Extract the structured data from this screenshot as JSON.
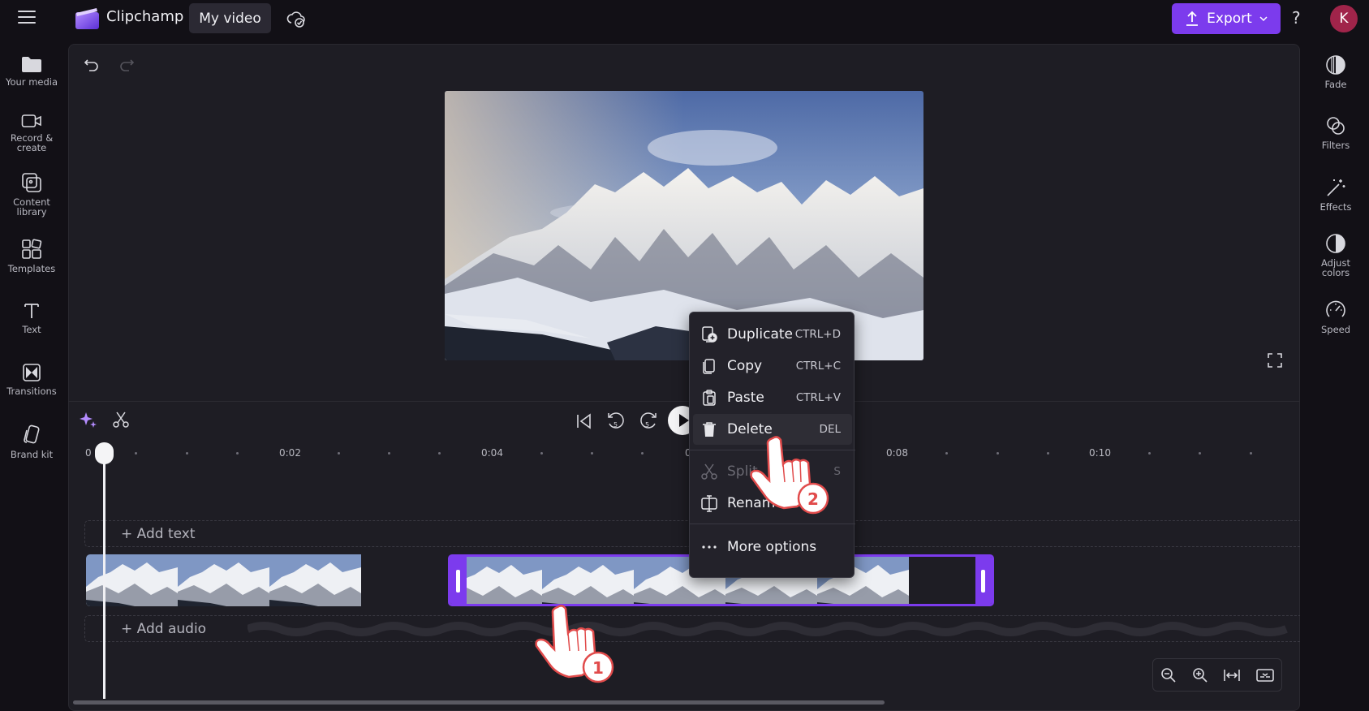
{
  "app": {
    "name": "Clipchamp",
    "project_tab": "My video",
    "export_label": "Export",
    "help": "?",
    "avatar_initial": "K",
    "accent": "#7c3bed"
  },
  "left_nav": [
    {
      "label": "Your media",
      "icon": "folder-icon"
    },
    {
      "label": "Record &",
      "label2": "create",
      "icon": "camera-icon"
    },
    {
      "label": "Content",
      "label2": "library",
      "icon": "library-icon"
    },
    {
      "label": "Templates",
      "icon": "templates-icon"
    },
    {
      "label": "Text",
      "icon": "text-icon"
    },
    {
      "label": "Transitions",
      "icon": "transitions-icon"
    },
    {
      "label": "Brand kit",
      "icon": "brand-kit-icon"
    }
  ],
  "right_nav": [
    {
      "label": "Fade",
      "icon": "fade-icon"
    },
    {
      "label": "Filters",
      "icon": "filters-icon"
    },
    {
      "label": "Effects",
      "icon": "effects-icon"
    },
    {
      "label": "Adjust",
      "label2": "colors",
      "icon": "adjust-colors-icon"
    },
    {
      "label": "Speed",
      "icon": "speed-icon"
    }
  ],
  "timeline": {
    "ruler": [
      "0",
      "0:02",
      "0:04",
      "0",
      "0:08",
      "0:10"
    ],
    "add_text": "+ Add text",
    "add_audio": "+ Add audio"
  },
  "context_menu": {
    "items": [
      {
        "label": "Duplicate",
        "shortcut": "CTRL+D",
        "icon": "duplicate-icon"
      },
      {
        "label": "Copy",
        "shortcut": "CTRL+C",
        "icon": "copy-icon"
      },
      {
        "label": "Paste",
        "shortcut": "CTRL+V",
        "icon": "paste-icon"
      },
      {
        "label": "Delete",
        "shortcut": "DEL",
        "icon": "delete-icon"
      },
      {
        "label": "Split",
        "shortcut": "S",
        "icon": "split-icon"
      },
      {
        "label": "Rename",
        "shortcut": "",
        "icon": "rename-icon"
      },
      {
        "label": "More options",
        "shortcut": "",
        "icon": "more-icon"
      }
    ]
  },
  "annotations": {
    "step1": "1",
    "step2": "2"
  }
}
